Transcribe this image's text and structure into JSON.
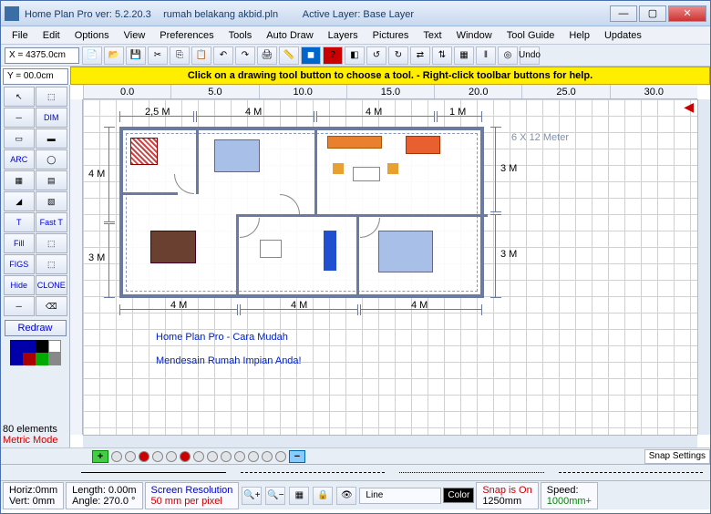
{
  "titlebar": {
    "app": "Home Plan Pro ver: 5.2.20.3",
    "file": "rumah belakang akbid.pln",
    "layer_label": "Active Layer: Base Layer"
  },
  "menu": [
    "File",
    "Edit",
    "Options",
    "View",
    "Preferences",
    "Tools",
    "Auto Draw",
    "Layers",
    "Pictures",
    "Text",
    "Window",
    "Tool Guide",
    "Help",
    "Updates"
  ],
  "coords": {
    "x": "X = 4375.0cm",
    "y": "Y = 00.0cm"
  },
  "hint": "Click on a drawing tool button to choose a tool.  -  Right-click toolbar buttons for help.",
  "tools": [
    "↖",
    "⬚",
    "─",
    "DIM",
    "▭",
    "▬",
    "ARC",
    "◯",
    "▦",
    "▤",
    "◢",
    "▧",
    "T",
    "Fast T",
    "Fill",
    "⬚",
    "FIGS",
    "Hide",
    "CLONE",
    "─",
    "⌫"
  ],
  "redraw": "Redraw",
  "palette": [
    "#0000aa",
    "#0000aa",
    "#000000",
    "#ffffff",
    "#0000aa",
    "#aa0000",
    "#00aa00",
    "#888888"
  ],
  "ruler": [
    "0.0",
    "5.0",
    "10.0",
    "15.0",
    "20.0",
    "25.0",
    "30.0"
  ],
  "dimensions": {
    "top": [
      "2,5 M",
      "4 M",
      "4 M",
      "1 M"
    ],
    "bottom": [
      "4 M",
      "4 M",
      "4 M"
    ],
    "left": [
      "4 M",
      "3 M"
    ],
    "right": [
      "3 M",
      "3 M"
    ],
    "overall": "6 X 12 Meter"
  },
  "annotation": {
    "line1": "Home Plan Pro - Cara Mudah",
    "line2": "Mendesain Rumah Impian Anda!"
  },
  "status": {
    "elements": "80 elements",
    "mode": "Metric Mode",
    "snap_settings": "Snap Settings",
    "horiz": "Horiz:0mm",
    "vert": "Vert: 0mm",
    "length": "Length: 0.00m",
    "angle": "Angle: 270.0 °",
    "res_label": "Screen Resolution",
    "res_value": "50 mm per pixel",
    "linetype": "Line",
    "color_btn": "Color",
    "snap_label": "Snap is On",
    "snap_value": "1250mm",
    "speed_label": "Speed:",
    "speed_value": "1000mm+"
  }
}
